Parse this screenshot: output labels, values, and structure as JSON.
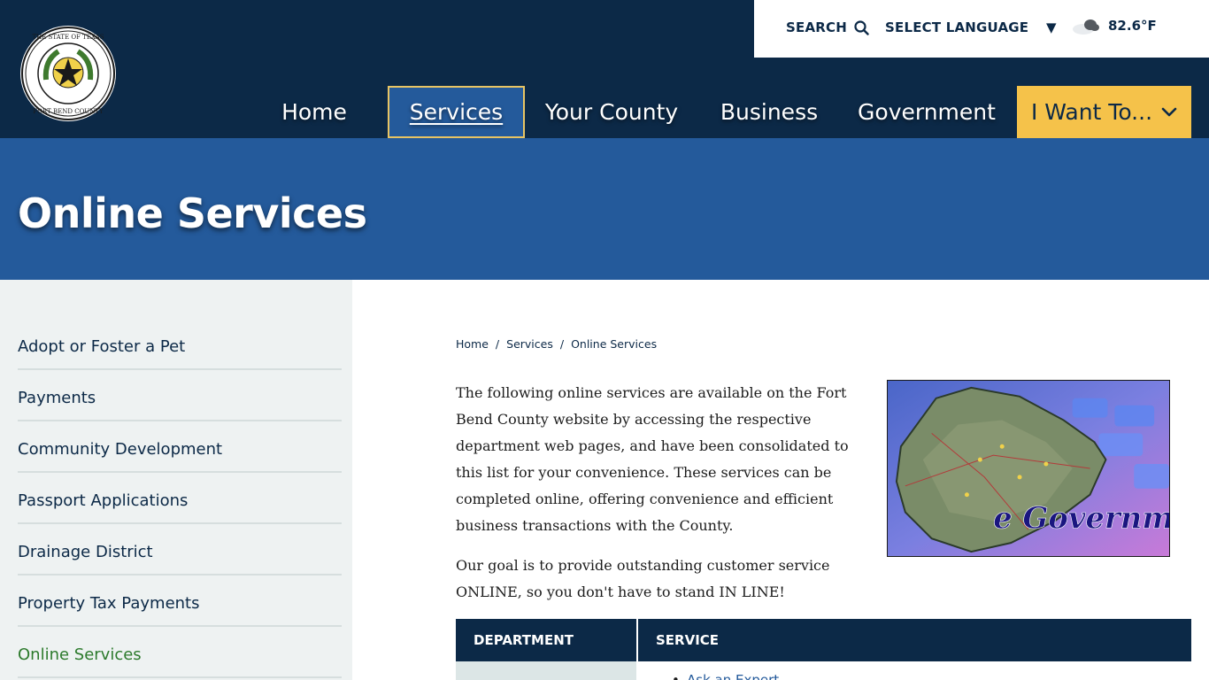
{
  "header": {
    "utility": {
      "search_label": "SEARCH",
      "language_label": "SELECT LANGUAGE",
      "temperature": "82.6°F"
    },
    "nav": [
      {
        "label": "Home"
      },
      {
        "label": "Services"
      },
      {
        "label": "Your County"
      },
      {
        "label": "Business"
      },
      {
        "label": "Government"
      },
      {
        "label": "I Want To..."
      }
    ]
  },
  "banner": {
    "title": "Online Services"
  },
  "sidebar": {
    "items": [
      {
        "label": "Adopt or Foster a Pet"
      },
      {
        "label": "Payments"
      },
      {
        "label": "Community Development"
      },
      {
        "label": "Passport Applications"
      },
      {
        "label": "Drainage District"
      },
      {
        "label": "Property Tax Payments"
      },
      {
        "label": "Online Services"
      }
    ]
  },
  "breadcrumb": [
    "Home",
    "Services",
    "Online Services"
  ],
  "content": {
    "paragraph1": "The following online services are available on the Fort Bend County website by accessing the respective department web pages, and have been consolidated to this list for your convenience. These services can be completed online, offering convenience and efficient business transactions with the County.",
    "paragraph2": "Our goal is to provide outstanding customer service ONLINE, so you don't have to stand IN LINE!",
    "image_text": "e Government"
  },
  "table": {
    "headers": [
      "DEPARTMENT",
      "SERVICE"
    ],
    "rows": [
      {
        "department": "",
        "services": [
          "Ask an Expert"
        ]
      }
    ]
  },
  "colors": {
    "navy": "#0c2947",
    "blue": "#245a9b",
    "gold": "#f5c24a",
    "sidebar_bg": "#eef2f2",
    "active_green": "#2c7a2c"
  }
}
